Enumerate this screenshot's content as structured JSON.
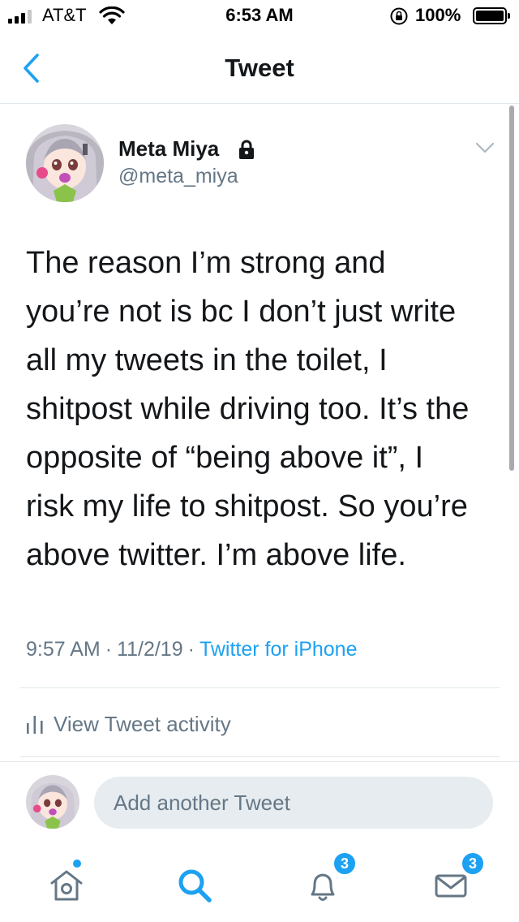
{
  "status_bar": {
    "carrier": "AT&T",
    "time": "6:53 AM",
    "battery": "100%",
    "icons": [
      "signal-icon",
      "wifi-icon",
      "orientation-lock-icon",
      "battery-icon"
    ]
  },
  "nav": {
    "title": "Tweet",
    "back_icon": "chevron-left-icon"
  },
  "tweet": {
    "author": {
      "name": "Meta Miya",
      "handle": "@meta_miya",
      "protected": true
    },
    "text": "The reason I’m strong and\nyou’re not is bc I don’t just write\nall my tweets in the toilet, I\nshitpost while driving too. It’s the\nopposite of “being above it”, I\nrisk my life to shitpost. So you’re\nabove twitter. I’m above life.",
    "time": "9:57 AM",
    "separator": "·",
    "date": "11/2/19",
    "source": "Twitter for iPhone"
  },
  "activity": {
    "label": "View Tweet activity",
    "icon": "bar-chart-icon"
  },
  "reply": {
    "placeholder": "Add another Tweet"
  },
  "tab_bar": {
    "items": [
      {
        "name": "home",
        "icon": "home-icon",
        "has_new_dot": true
      },
      {
        "name": "search",
        "icon": "search-icon",
        "active": true
      },
      {
        "name": "notifications",
        "icon": "bell-icon",
        "badge": "3"
      },
      {
        "name": "messages",
        "icon": "envelope-icon",
        "badge": "3"
      }
    ]
  },
  "colors": {
    "accent": "#1da1f2",
    "text": "#14171a",
    "secondary": "#657786",
    "divider": "#e1e8ed",
    "input_bg": "#e6ecf0"
  }
}
